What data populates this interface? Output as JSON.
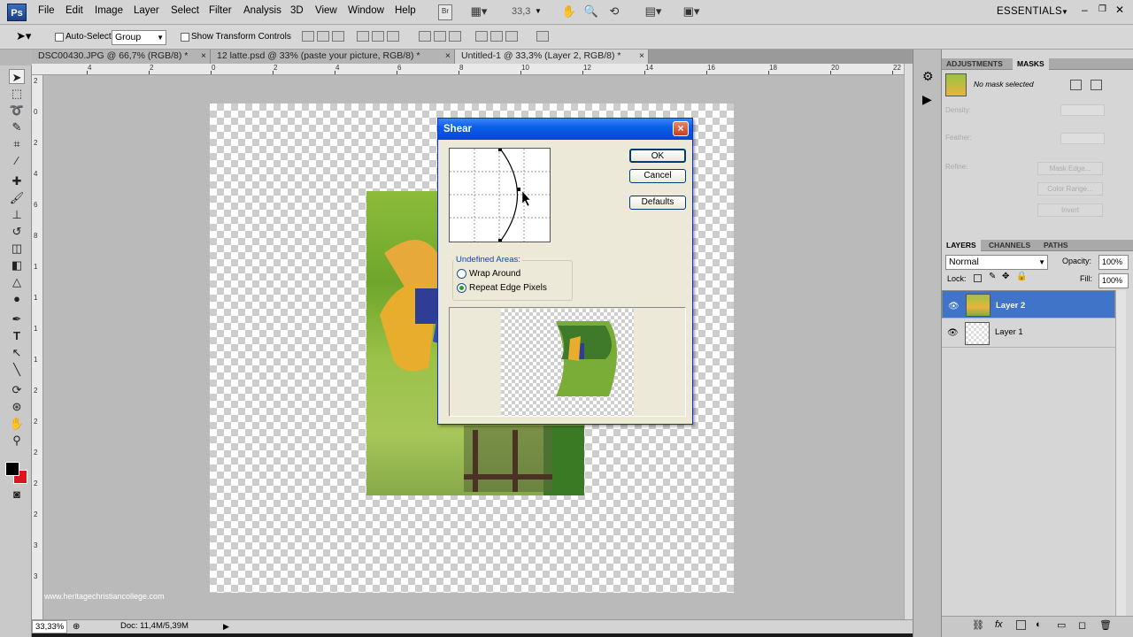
{
  "app": {
    "logo": "Ps"
  },
  "menubar": {
    "items": [
      "File",
      "Edit",
      "Image",
      "Layer",
      "Select",
      "Filter",
      "Analysis",
      "3D",
      "View",
      "Window",
      "Help"
    ],
    "zoom": "33,3",
    "workspace": "ESSENTIALS"
  },
  "options": {
    "auto_select_label": "Auto-Select:",
    "auto_select_value": "Group",
    "transform_label": "Show Transform Controls"
  },
  "tabs": [
    {
      "label": "DSC00430.JPG @ 66,7% (RGB/8) *",
      "close": "×"
    },
    {
      "label": "12 latte.psd @ 33% (paste your picture, RGB/8) *",
      "close": "×"
    },
    {
      "label": "Untitled-1 @ 33,3% (Layer 2, RGB/8) *",
      "close": "×"
    }
  ],
  "rulers": {
    "top": [
      "4",
      "2",
      "0",
      "2",
      "4",
      "6",
      "8",
      "10",
      "12",
      "14",
      "16",
      "18",
      "20",
      "22"
    ],
    "left": [
      "2",
      "0",
      "2",
      "4",
      "6",
      "8",
      "1",
      "1",
      "1",
      "1",
      "2",
      "2",
      "2",
      "2",
      "2",
      "3",
      "3"
    ]
  },
  "watermark": "www.heritagechristiancollege.com",
  "status": {
    "zoom": "33,33%",
    "doc": "Doc: 11,4M/5,39M"
  },
  "dialog": {
    "title": "Shear",
    "close": "×",
    "ok": "OK",
    "cancel": "Cancel",
    "defaults": "Defaults",
    "undefined_areas": "Undefined Areas:",
    "wrap_around": "Wrap Around",
    "repeat_edge": "Repeat Edge Pixels",
    "selected_option": "Repeat Edge Pixels"
  },
  "panels": {
    "top_tabs": [
      "ADJUSTMENTS",
      "MASKS"
    ],
    "active_top_tab": "MASKS",
    "no_mask": "No mask selected",
    "density": "Density:",
    "feather": "Feather:",
    "refine": "Refine:",
    "mask_edge": "Mask Edge...",
    "color_range": "Color Range...",
    "invert": "Invert",
    "layer_tabs": [
      "LAYERS",
      "CHANNELS",
      "PATHS"
    ],
    "blend_mode": "Normal",
    "opacity_label": "Opacity:",
    "opacity": "100%",
    "lock_label": "Lock:",
    "fill_label": "Fill:",
    "fill": "100%",
    "layers": [
      {
        "name": "Layer 2",
        "selected": true
      },
      {
        "name": "Layer 1",
        "selected": false
      }
    ]
  },
  "colors": {
    "foreground": "#000000",
    "background": "#e0141e",
    "selection": "#3f74c9"
  }
}
